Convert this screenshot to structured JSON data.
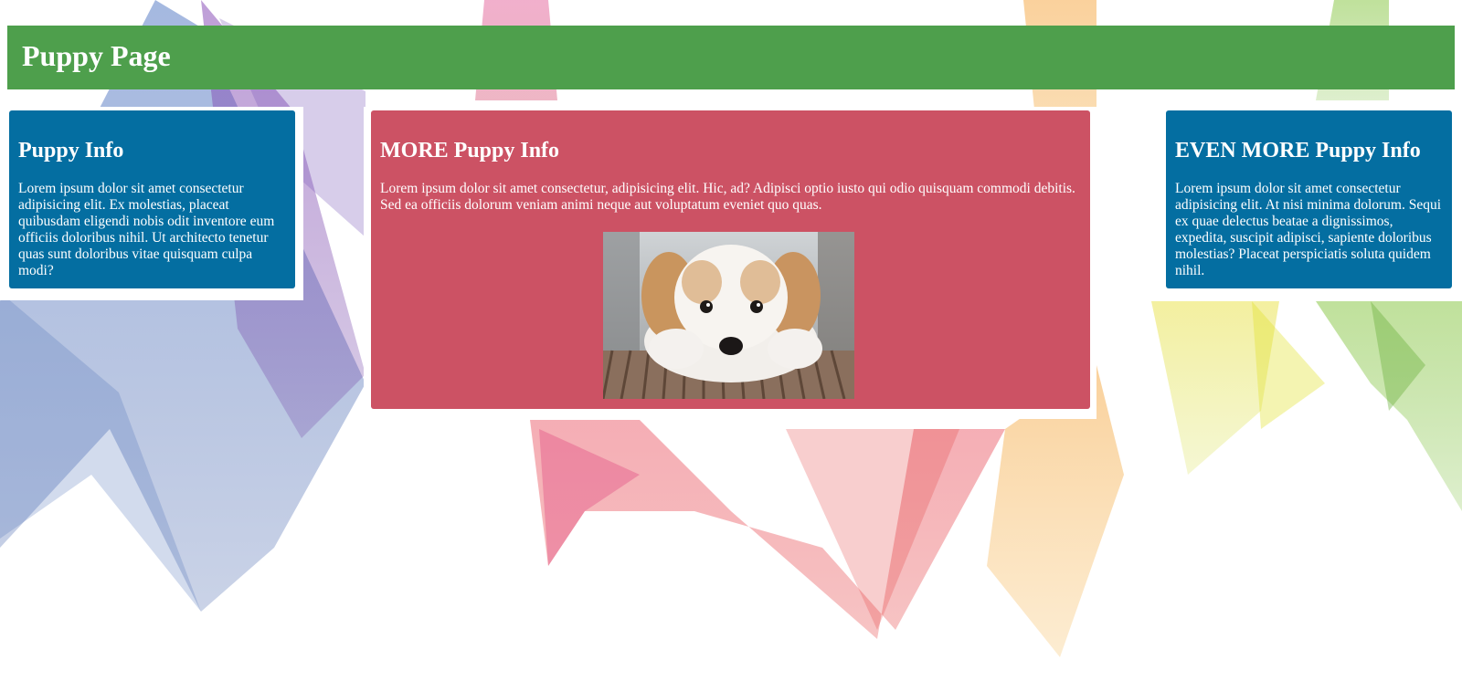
{
  "header": {
    "title": "Puppy Page"
  },
  "cards": {
    "left": {
      "title": "Puppy Info",
      "text": "Lorem ipsum dolor sit amet consectetur adipisicing elit. Ex molestias, placeat quibusdam eligendi nobis odit inventore eum officiis doloribus nihil. Ut architecto tenetur quas sunt doloribus vitae quisquam culpa modi?"
    },
    "middle": {
      "title": "MORE Puppy Info",
      "text": "Lorem ipsum dolor sit amet consectetur, adipisicing elit. Hic, ad? Adipisci optio iusto qui odio quisquam commodi debitis. Sed ea officiis dolorum veniam animi neque aut voluptatum eveniet quo quas."
    },
    "right": {
      "title": "EVEN MORE Puppy Info",
      "text": "Lorem ipsum dolor sit amet consectetur adipisicing elit. At nisi minima dolorum. Sequi ex quae delectus beatae a dignissimos, expedita, suscipit adipisci, sapiente doloribus molestias? Placeat perspiciatis soluta quidem nihil."
    }
  },
  "colors": {
    "header": "#4e9f4c",
    "card_blue": "#046ea1",
    "card_red": "#cc5264",
    "text": "#ffffff"
  }
}
